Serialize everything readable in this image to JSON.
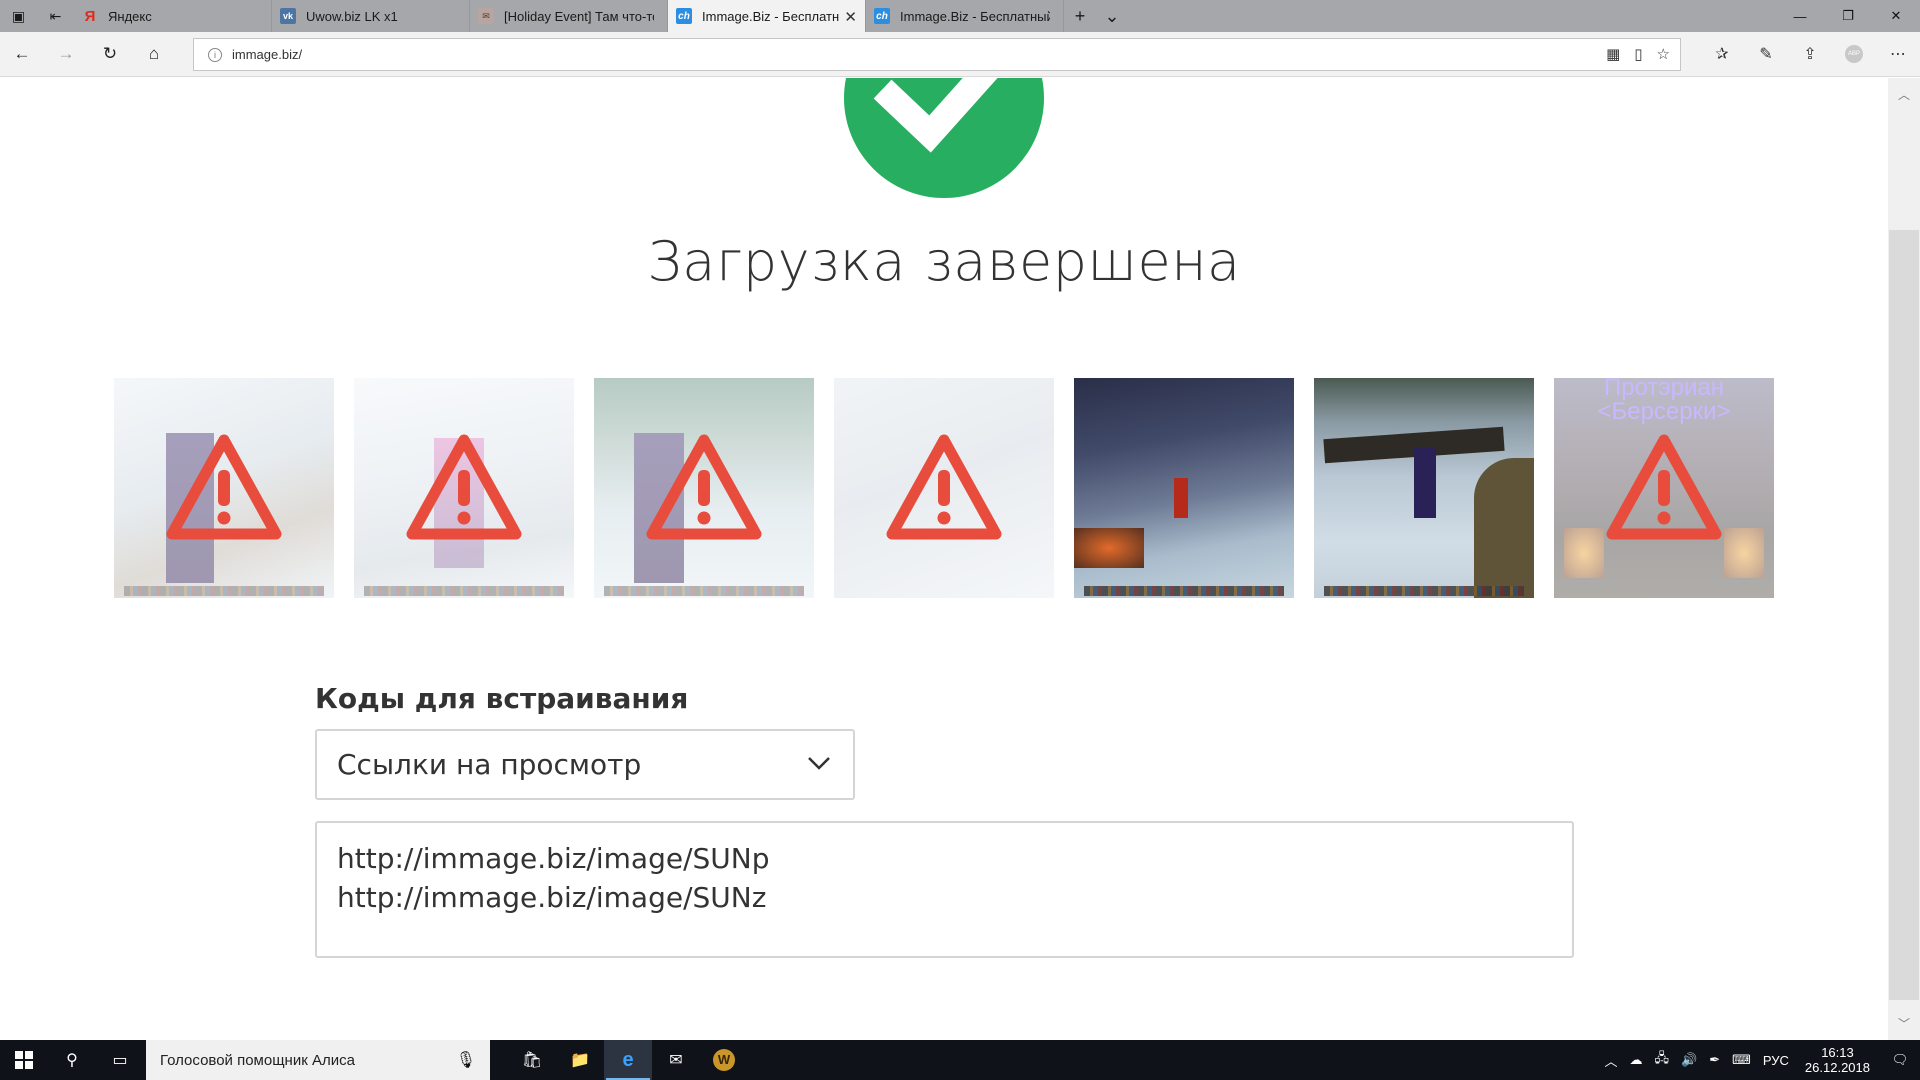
{
  "browser": {
    "tabs": [
      {
        "label": "Яндекс",
        "icon": "yandex-favicon",
        "active": false
      },
      {
        "label": "Uwow.biz LK x1",
        "icon": "vk-favicon",
        "active": false
      },
      {
        "label": "[Holiday Event] Там что-то",
        "icon": "forum-favicon",
        "active": false
      },
      {
        "label": "Immage.Biz - Бесплатн",
        "icon": "immage-favicon",
        "active": true
      },
      {
        "label": "Immage.Biz - Бесплатный х",
        "icon": "immage-favicon",
        "active": false
      }
    ],
    "url": "immage.biz/"
  },
  "page": {
    "title": "Загрузка завершена",
    "thumbnails": [
      {
        "status": "error",
        "overlay_text": ""
      },
      {
        "status": "error",
        "overlay_text": ""
      },
      {
        "status": "error",
        "overlay_text": ""
      },
      {
        "status": "error",
        "overlay_text": ""
      },
      {
        "status": "ok",
        "overlay_text": ""
      },
      {
        "status": "ok",
        "overlay_text": ""
      },
      {
        "status": "error",
        "overlay_text": "Протэриан <Берсерки>"
      }
    ],
    "embed": {
      "label": "Коды для встраивания",
      "selected_option": "Ссылки на просмотр",
      "codes": [
        "http://immage.biz/image/SUNp",
        "http://immage.biz/image/SUNz"
      ]
    }
  },
  "taskbar": {
    "search_placeholder": "Голосовой помощник Алиса",
    "language": "РУС",
    "time": "16:13",
    "date": "26.12.2018"
  },
  "colors": {
    "success": "#27ae60",
    "warning": "#e74c3c"
  }
}
